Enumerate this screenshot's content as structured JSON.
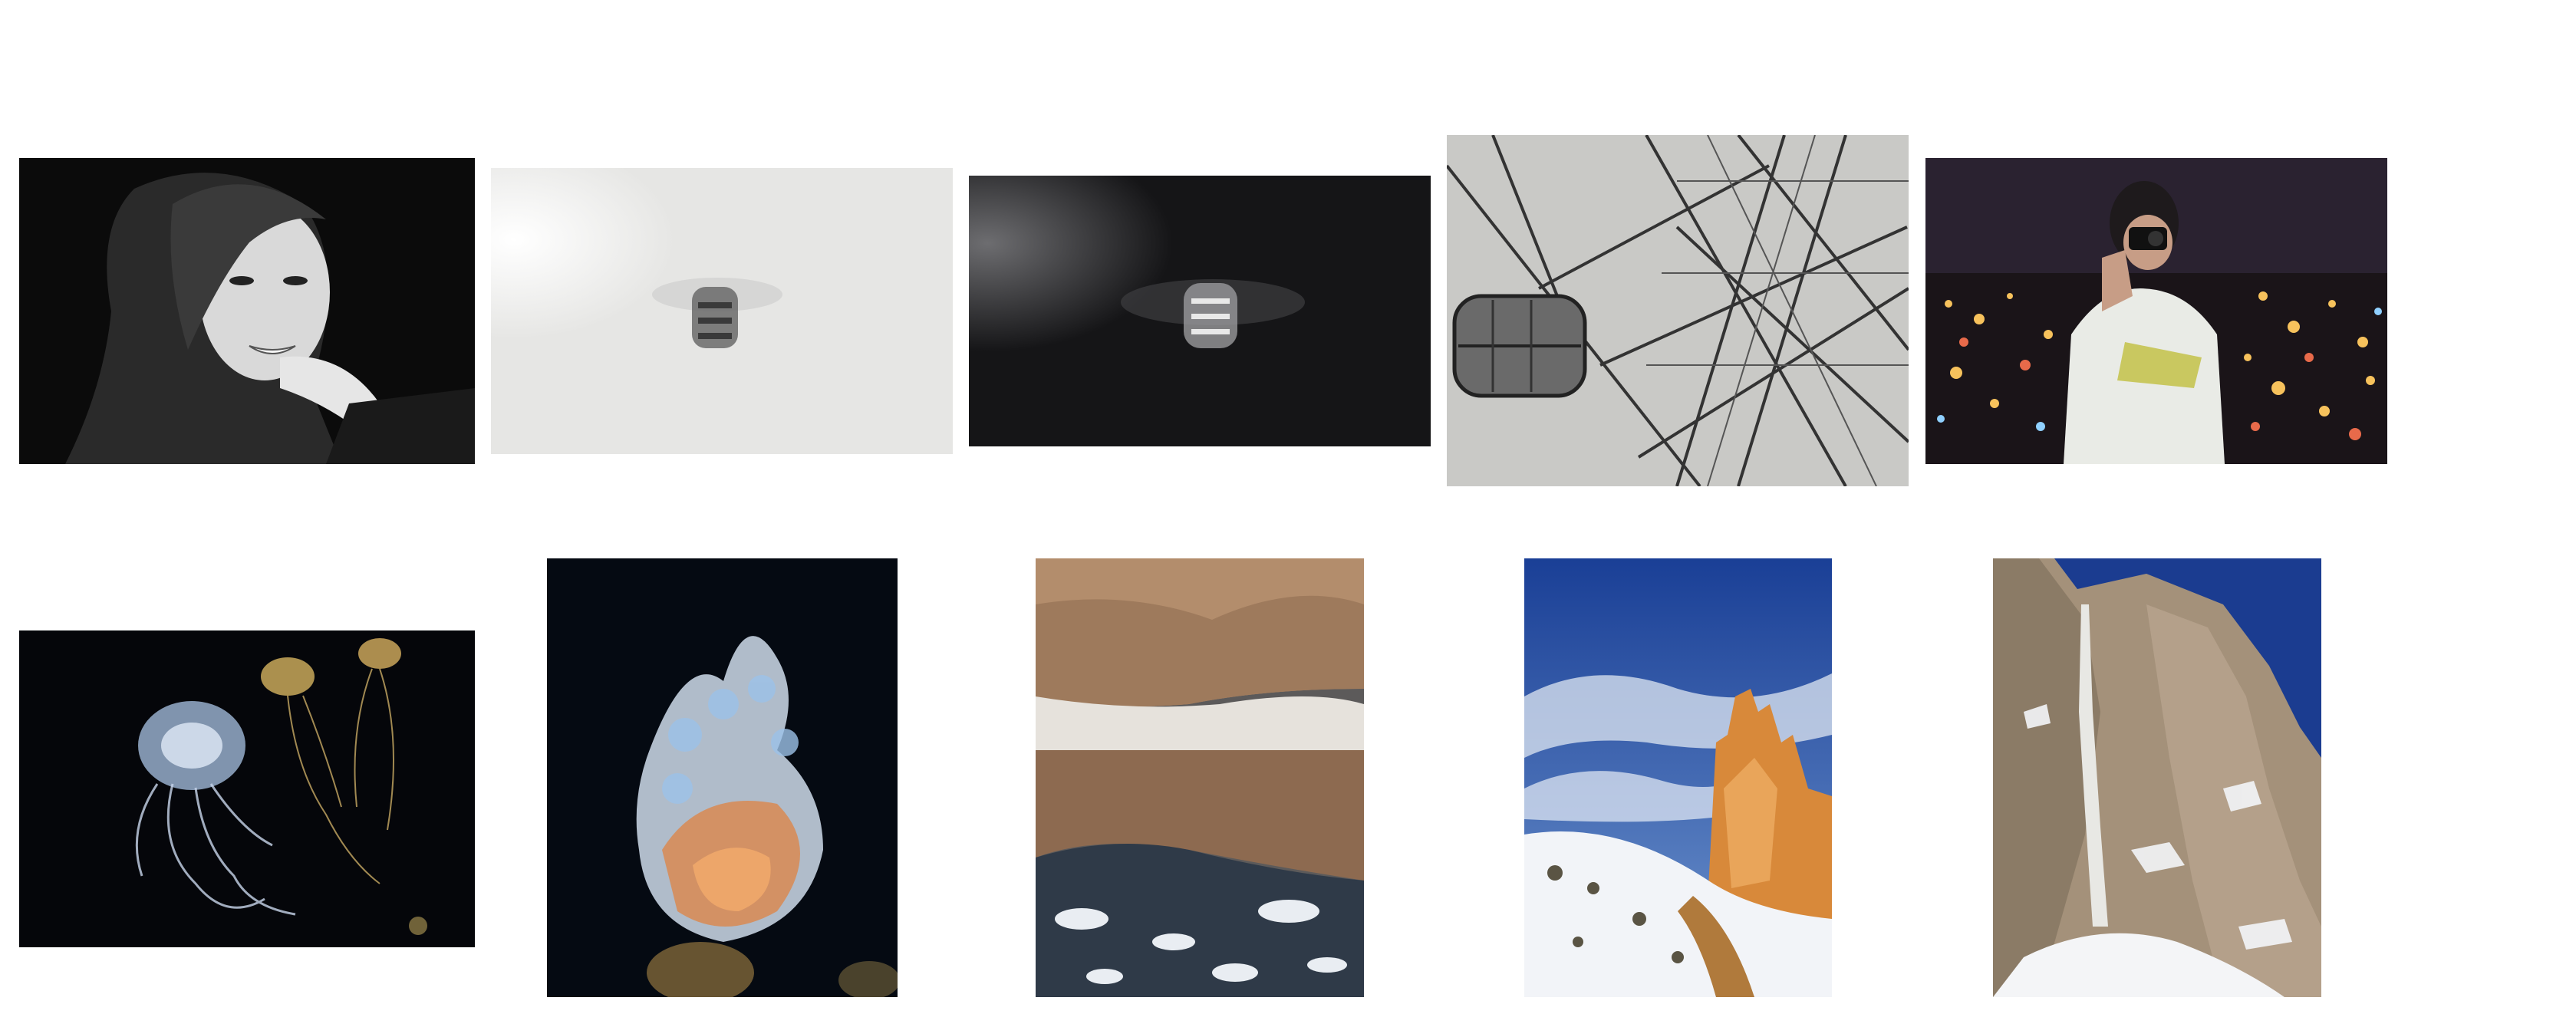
{
  "gallery": {
    "row_top": [
      {
        "subject": "portrait",
        "description_icon": "portrait-photo-icon",
        "tone": "monochrome"
      },
      {
        "subject": "jellyfish-blurred-light",
        "description_icon": "jellyfish-photo-icon",
        "tone": "monochrome"
      },
      {
        "subject": "jellyfish-blurred-dark",
        "description_icon": "jellyfish-photo-icon",
        "tone": "monochrome"
      },
      {
        "subject": "ferris-wheel",
        "description_icon": "ferris-wheel-photo-icon",
        "tone": "monochrome"
      },
      {
        "subject": "photographer-night-city",
        "description_icon": "photographer-photo-icon",
        "tone": "color"
      }
    ],
    "row_bottom": [
      {
        "subject": "jellyfish-group",
        "description_icon": "jellyfish-photo-icon",
        "tone": "color"
      },
      {
        "subject": "jellyfish-close-up",
        "description_icon": "jellyfish-photo-icon",
        "tone": "color"
      },
      {
        "subject": "mountain-reflection",
        "description_icon": "landscape-photo-icon",
        "tone": "color"
      },
      {
        "subject": "rock-spire-snow",
        "description_icon": "landscape-photo-icon",
        "tone": "color"
      },
      {
        "subject": "waterfall-cliff",
        "description_icon": "landscape-photo-icon",
        "tone": "color"
      }
    ],
    "colors": {
      "background": "#ffffff",
      "night_sky": "#2a1f2c",
      "sky_blue": "#1e4aa8",
      "rock_orange": "#d8893a",
      "snow": "#f2f4f8"
    }
  }
}
